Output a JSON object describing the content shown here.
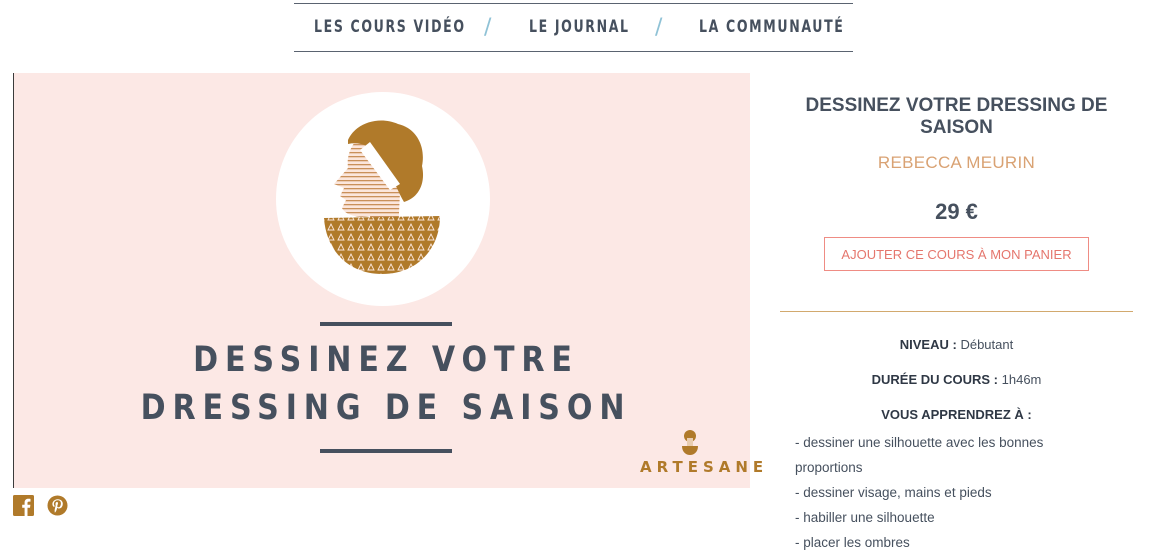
{
  "nav": {
    "items": [
      "LES COURS VIDÉO",
      "LE JOURNAL",
      "LA COMMUNAUTÉ"
    ],
    "separator": "/"
  },
  "hero": {
    "title_line1": "DESSINEZ VOTRE",
    "title_line2": "DRESSING DE SAISON",
    "brand": "ARTESANE",
    "colors": {
      "background": "#fce8e5",
      "ochre": "#b07a2a",
      "slate": "#46505e"
    }
  },
  "social": {
    "icons": [
      "facebook-icon",
      "pinterest-icon"
    ],
    "color": "#b07a2a"
  },
  "course": {
    "title": "DESSINEZ VOTRE DRESSING DE SAISON",
    "author": "REBECCA MEURIN",
    "price": "29 €",
    "cart_label": "AJOUTER CE COURS À MON PANIER"
  },
  "details": {
    "level_label": "NIVEAU :",
    "level_value": "Débutant",
    "duration_label": "DURÉE DU COURS :",
    "duration_value": "1h46m",
    "learn_heading": "VOUS APPRENDREZ À :",
    "learn_items": [
      "- dessiner une silhouette avec les bonnes proportions",
      "- dessiner visage, mains et pieds",
      "- habiller une silhouette",
      "- placer les ombres"
    ]
  }
}
